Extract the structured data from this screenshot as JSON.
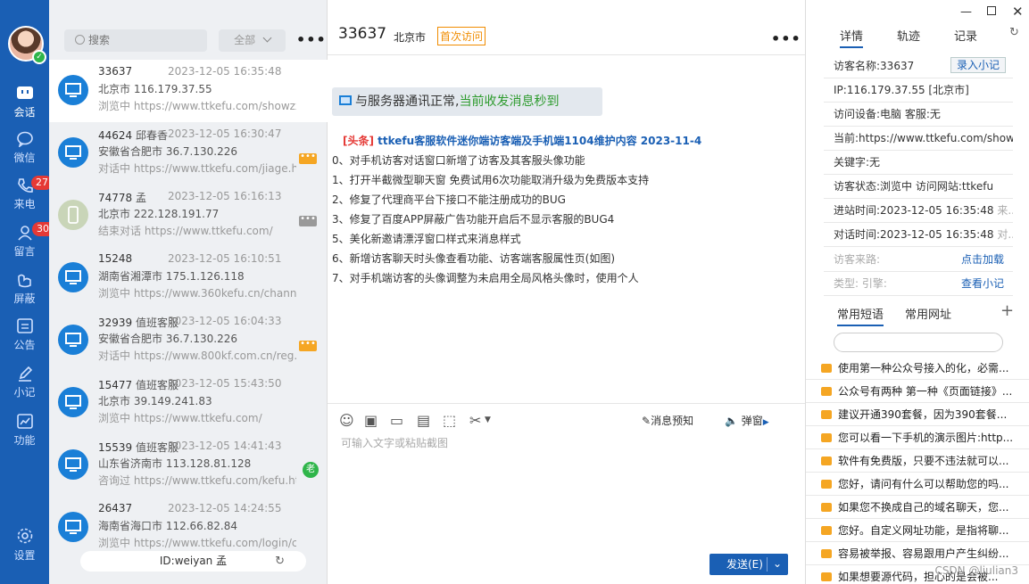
{
  "nav": {
    "items": [
      {
        "label": "会话",
        "badge": ""
      },
      {
        "label": "微信",
        "badge": ""
      },
      {
        "label": "来电",
        "badge": "27"
      },
      {
        "label": "留言",
        "badge": "300"
      },
      {
        "label": "屏蔽",
        "badge": ""
      },
      {
        "label": "公告",
        "badge": ""
      },
      {
        "label": "小记",
        "badge": ""
      },
      {
        "label": "功能",
        "badge": ""
      }
    ],
    "settings_label": "设置"
  },
  "list": {
    "search_placeholder": "搜索",
    "filter_label": "全部",
    "more": "•••",
    "items": [
      {
        "id": "33637",
        "name": "",
        "time": "2023-12-05 16:35:48",
        "location": "北京市  116.179.37.55",
        "url": "浏览中 https://www.ttkefu.com/showzx.html",
        "flag": ""
      },
      {
        "id": "44624",
        "name": "邱春香",
        "time": "2023-12-05 16:30:47",
        "location": "安徽省合肥市  36.7.130.226",
        "url": "对话中 https://www.ttkefu.com/jiage.html",
        "flag": "•••"
      },
      {
        "id": "74778",
        "name": "孟",
        "time": "2023-12-05 16:16:13",
        "location": "北京市  222.128.191.77",
        "url": "结束对话 https://www.ttkefu.com/",
        "flag": "•••"
      },
      {
        "id": "15248",
        "name": "",
        "time": "2023-12-05 16:10:51",
        "location": "湖南省湘潭市  175.1.126.118",
        "url": "浏览中 https://www.360kefu.cn/channels/",
        "flag": ""
      },
      {
        "id": "32939",
        "name": "值班客服",
        "time": "2023-12-05 16:04:33",
        "location": "安徽省合肥市  36.7.130.226",
        "url": "对话中 https://www.800kf.com.cn/reg.html",
        "flag": "•••"
      },
      {
        "id": "15477",
        "name": "值班客服",
        "time": "2023-12-05 15:43:50",
        "location": "北京市  39.149.241.83",
        "url": "浏览中 https://www.ttkefu.com/",
        "flag": ""
      },
      {
        "id": "15539",
        "name": "值班客服",
        "time": "2023-12-05 14:41:43",
        "location": "山东省济南市  113.128.81.128",
        "url": "咨询过 https://www.ttkefu.com/kefu.html",
        "flag": "老"
      },
      {
        "id": "26437",
        "name": "",
        "time": "2023-12-05 14:24:55",
        "location": "海南省海口市  112.66.82.84",
        "url": "浏览中 https://www.ttkefu.com/login/chen",
        "flag": ""
      }
    ],
    "id_bar": "ID:weiyan 孟",
    "refresh_icon": "↻"
  },
  "chat": {
    "visitor_id": "33637",
    "city": "北京市",
    "visit_tag": "首次访问",
    "more": "•••",
    "notice_prefix": "与服务器通讯正常,",
    "notice_green": "当前收发消息秒到",
    "news_tag": "[头条]",
    "news_title": " ttkefu客服软件迷你端访客端及手机端1104维护内容 2023-11-4",
    "news_lines": [
      "0、对手机访客对话窗口新增了访客及其客服头像功能",
      "1、打开半截微型聊天窗 免费试用6次功能取消升级为免费版本支持",
      "2、修复了代理商平台下接口不能注册成功的BUG",
      "3、修复了百度APP屏蔽广告功能开启后不显示客服的BUG4",
      "5、美化新邀请漂浮窗口样式来消息样式",
      "6、新增访客聊天时头像查看功能、访客端客服属性页(如图)",
      "7、对手机端访客的头像调整为未启用全局风格头像时，使用个人"
    ],
    "toolbar_preview": "消息预知",
    "toolbar_popup": "弹窗",
    "input_placeholder": "可输入文字或粘贴截图",
    "send_label": "发送(E)"
  },
  "right": {
    "tabs": [
      "详情",
      "轨迹",
      "记录"
    ],
    "details": [
      {
        "text": "访客名称:33637",
        "muted": "",
        "link": "录入小记"
      },
      {
        "text": "IP:116.179.37.55 [北京市]",
        "muted": "",
        "link": ""
      },
      {
        "text": "访问设备:电脑   客服:无",
        "muted": "",
        "link": ""
      },
      {
        "text": "当前:https://www.ttkefu.com/showz...",
        "muted": "",
        "link": ""
      },
      {
        "text": "关键字:无",
        "muted": "",
        "link": ""
      },
      {
        "text": "访客状态:浏览中  访问网站:ttkefu",
        "muted": "",
        "link": ""
      },
      {
        "text": "进站时间:2023-12-05 16:35:48 ",
        "muted": "来...",
        "link": ""
      },
      {
        "text": "对话时间:2023-12-05 16:35:48 ",
        "muted": "对...",
        "link": ""
      },
      {
        "text": "",
        "muted": "访客来路:",
        "link": "点击加载"
      },
      {
        "text": "",
        "muted": "类型: 引擎:",
        "link": "查看小记"
      }
    ],
    "quick_tabs": [
      "常用短语",
      "常用网址"
    ],
    "add": "+",
    "phrases": [
      "使用第一种公众号接入的化，必需...",
      "公众号有两种 第一种《页面链接》...",
      "建议开通390套餐，因为390套餐...",
      "您可以看一下手机的演示图片:http...",
      "软件有免费版，只要不违法就可以...",
      "您好，请问有什么可以帮助您的吗...",
      "如果您不换成自己的域名聊天，您...",
      "您好。自定义网址功能，是指将聊...",
      "容易被举报、容易跟用户产生纠纷...",
      "如果想要源代码，担心的是会被..."
    ],
    "watermark": "CSDN @liulian3"
  }
}
